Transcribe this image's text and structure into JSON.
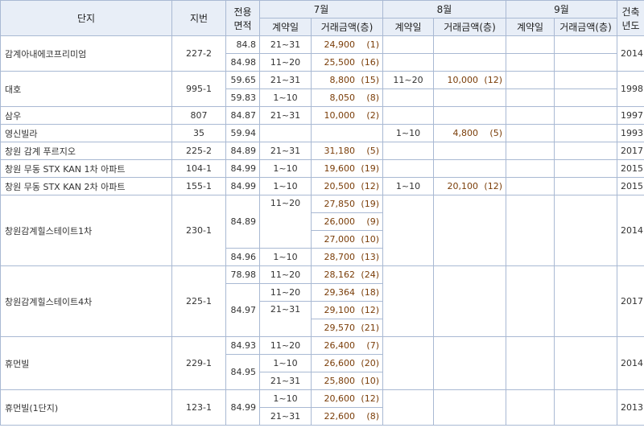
{
  "headers": {
    "complex": "단지",
    "lot": "지번",
    "area_line1": "전용",
    "area_line2": "면적",
    "months": [
      "7월",
      "8월",
      "9월"
    ],
    "built_line1": "건축",
    "built_line2": "년도",
    "contract_day": "계약일",
    "price": "거래금액(층)"
  },
  "complexes": [
    {
      "name": "감계아내에코프리미엄",
      "lot": "227-2",
      "built": "2014"
    },
    {
      "name": "대호",
      "lot": "995-1",
      "built": "1998"
    },
    {
      "name": "삼우",
      "lot": "807",
      "built": "1997"
    },
    {
      "name": "영신빌라",
      "lot": "35",
      "built": "1993"
    },
    {
      "name": "창원 감계 푸르지오",
      "lot": "225-2",
      "built": "2017"
    },
    {
      "name": "창원 무동 STX KAN 1차 아파트",
      "lot": "104-1",
      "built": "2015"
    },
    {
      "name": "창원 무동 STX KAN 2차 아파트",
      "lot": "155-1",
      "built": "2015"
    },
    {
      "name": "창원감계힐스테이트1차",
      "lot": "230-1",
      "built": "2014"
    },
    {
      "name": "창원감계힐스테이트4차",
      "lot": "225-1",
      "built": "2017"
    },
    {
      "name": "휴먼빌",
      "lot": "229-1",
      "built": "2014"
    },
    {
      "name": "휴먼빌(1단지)",
      "lot": "123-1",
      "built": "2013"
    }
  ],
  "rows": [
    {
      "area": "84.8",
      "jul_day": "21~31",
      "jul_price": "24,900",
      "jul_floor": "(1)"
    },
    {
      "area": "84.98",
      "jul_day": "11~20",
      "jul_price": "25,500",
      "jul_floor": "(16)"
    },
    {
      "area": "59.65",
      "jul_day": "21~31",
      "jul_price": "8,800",
      "jul_floor": "(15)",
      "aug_day": "11~20",
      "aug_price": "10,000",
      "aug_floor": "(12)"
    },
    {
      "area": "59.83",
      "jul_day": "1~10",
      "jul_price": "8,050",
      "jul_floor": "(8)"
    },
    {
      "area": "84.87",
      "jul_day": "21~31",
      "jul_price": "10,000",
      "jul_floor": "(2)"
    },
    {
      "area": "59.94",
      "aug_day": "1~10",
      "aug_price": "4,800",
      "aug_floor": "(5)"
    },
    {
      "area": "84.89",
      "jul_day": "21~31",
      "jul_price": "31,180",
      "jul_floor": "(5)"
    },
    {
      "area": "84.99",
      "jul_day": "1~10",
      "jul_price": "19,600",
      "jul_floor": "(19)"
    },
    {
      "area": "84.99",
      "jul_day": "1~10",
      "jul_price": "20,500",
      "jul_floor": "(12)",
      "aug_day": "1~10",
      "aug_price": "20,100",
      "aug_floor": "(12)"
    },
    {
      "area": "84.89",
      "jul_day": "11~20",
      "jul_price": "27,850",
      "jul_floor": "(19)"
    },
    {
      "jul_price": "26,000",
      "jul_floor": "(9)"
    },
    {
      "jul_price": "27,000",
      "jul_floor": "(10)"
    },
    {
      "area": "84.96",
      "jul_day": "1~10",
      "jul_price": "28,700",
      "jul_floor": "(13)"
    },
    {
      "area": "78.98",
      "jul_day": "11~20",
      "jul_price": "28,162",
      "jul_floor": "(24)"
    },
    {
      "area": "84.97",
      "jul_day": "11~20",
      "jul_price": "29,364",
      "jul_floor": "(18)"
    },
    {
      "jul_day": "21~31",
      "jul_price": "29,100",
      "jul_floor": "(12)"
    },
    {
      "jul_price": "29,570",
      "jul_floor": "(21)"
    },
    {
      "area": "84.93",
      "jul_day": "11~20",
      "jul_price": "26,400",
      "jul_floor": "(7)"
    },
    {
      "area": "84.95",
      "jul_day": "1~10",
      "jul_price": "26,600",
      "jul_floor": "(20)"
    },
    {
      "jul_day": "21~31",
      "jul_price": "25,800",
      "jul_floor": "(10)"
    },
    {
      "area": "84.99",
      "jul_day": "1~10",
      "jul_price": "20,600",
      "jul_floor": "(12)"
    },
    {
      "jul_day": "21~31",
      "jul_price": "22,600",
      "jul_floor": "(8)"
    }
  ]
}
